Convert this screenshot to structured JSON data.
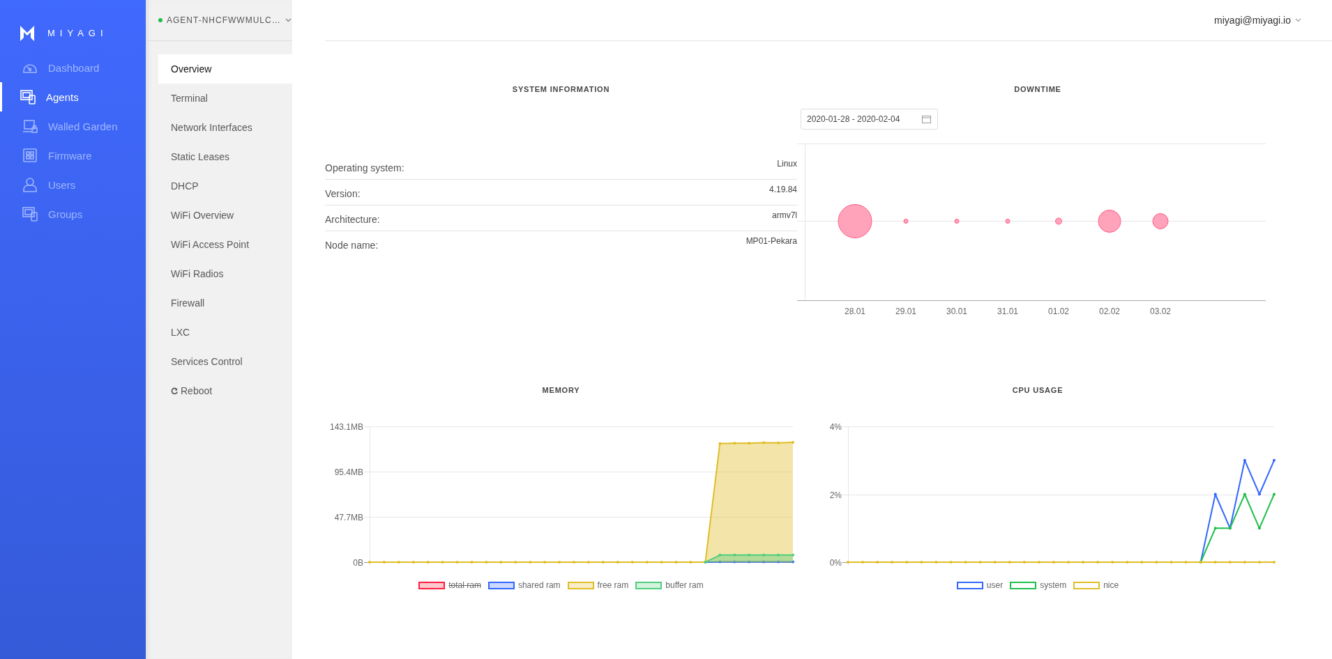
{
  "sidebar": {
    "logo": "MIYAGI",
    "items": [
      {
        "label": "Dashboard",
        "selected": false
      },
      {
        "label": "Agents",
        "selected": true
      },
      {
        "label": "Walled Garden",
        "selected": false
      },
      {
        "label": "Firmware",
        "selected": false
      },
      {
        "label": "Users",
        "selected": false
      },
      {
        "label": "Groups",
        "selected": false
      }
    ]
  },
  "agent_menu": {
    "agent": "AGENT-NHCFWWMULC…",
    "online": true,
    "items": [
      {
        "label": "Overview",
        "kind": "page",
        "selected": true
      },
      {
        "label": "Terminal",
        "kind": "page",
        "selected": false
      },
      {
        "label": "Network Interfaces",
        "kind": "page",
        "selected": false
      },
      {
        "label": "Static Leases",
        "kind": "page",
        "selected": false
      },
      {
        "label": "DHCP",
        "kind": "page",
        "selected": false
      },
      {
        "label": "WiFi Overview",
        "kind": "page",
        "selected": false
      },
      {
        "label": "WiFi Access Point",
        "kind": "page",
        "selected": false
      },
      {
        "label": "WiFi Radios",
        "kind": "page",
        "selected": false
      },
      {
        "label": "Firewall",
        "kind": "page",
        "selected": false
      },
      {
        "label": "LXC",
        "kind": "page",
        "selected": false
      },
      {
        "label": "Services Control",
        "kind": "page",
        "selected": false
      },
      {
        "label": "Reboot",
        "kind": "action",
        "selected": false
      }
    ]
  },
  "header": {
    "user": "miyagi@miyagi.io"
  },
  "system_information": {
    "title": "SYSTEM INFORMATION",
    "rows": [
      {
        "label": "Operating system:",
        "value": "Linux"
      },
      {
        "label": "Version:",
        "value": "4.19.84"
      },
      {
        "label": "Architecture:",
        "value": "armv7l"
      },
      {
        "label": "Node name:",
        "value": "MP01-Pekara"
      }
    ]
  },
  "downtime": {
    "title": "DOWNTIME",
    "date_range": "2020-01-28 - 2020-02-04",
    "x_labels": [
      "28.01",
      "29.01",
      "30.01",
      "31.01",
      "01.02",
      "02.02",
      "03.02"
    ]
  },
  "memory": {
    "title": "MEMORY",
    "legend": [
      {
        "hidden": true
      },
      {
        "hidden": false
      },
      {
        "hidden": false
      },
      {
        "hidden": false
      }
    ],
    "chart_data": {
      "type": "area",
      "ylim": [
        0,
        143.1
      ],
      "yticks": [
        {
          "value": 0,
          "label": "0B"
        },
        {
          "value": 47.7,
          "label": "47.7MB"
        },
        {
          "value": 95.4,
          "label": "95.4MB"
        },
        {
          "value": 143.1,
          "label": "143.1MB"
        }
      ],
      "series": [
        {
          "name": "total ram",
          "color": "#ff1f3d",
          "values": [
            null,
            null,
            null,
            null,
            null,
            null,
            null,
            null,
            null,
            null,
            null,
            null,
            null,
            null,
            null,
            null,
            null,
            null,
            null,
            null,
            null,
            null,
            null,
            null,
            null,
            null,
            null,
            null,
            null,
            null
          ]
        },
        {
          "name": "shared ram",
          "color": "#3366ff",
          "values": [
            null,
            null,
            null,
            null,
            null,
            null,
            null,
            null,
            null,
            null,
            null,
            null,
            null,
            null,
            null,
            null,
            null,
            null,
            null,
            null,
            null,
            null,
            null,
            0,
            0.3,
            0.3,
            0.3,
            0.3,
            0.3,
            0.3
          ]
        },
        {
          "name": "free ram",
          "color": "#e0bd27",
          "values": [
            0,
            0,
            0,
            0,
            0,
            0,
            0,
            0,
            0,
            0,
            0,
            0,
            0,
            0,
            0,
            0,
            0,
            0,
            0,
            0,
            0,
            0,
            0,
            0,
            125,
            125.3,
            125.3,
            125.8,
            125.6,
            126.2
          ]
        },
        {
          "name": "buffer ram",
          "color": "#4fce7d",
          "values": [
            null,
            null,
            null,
            null,
            null,
            null,
            null,
            null,
            null,
            null,
            null,
            null,
            null,
            null,
            null,
            null,
            null,
            null,
            null,
            null,
            null,
            null,
            null,
            0,
            7.5,
            7.5,
            7.5,
            7.5,
            7.5,
            7.5
          ]
        }
      ]
    }
  },
  "cpu_usage": {
    "title": "CPU USAGE",
    "legend": [
      {
        "hidden": false
      },
      {
        "hidden": false
      },
      {
        "hidden": false
      }
    ],
    "chart_data": {
      "type": "line",
      "ylim": [
        0,
        4
      ],
      "yticks": [
        {
          "value": 0,
          "label": "0%"
        },
        {
          "value": 2,
          "label": "2%"
        },
        {
          "value": 4,
          "label": "4%"
        }
      ],
      "series": [
        {
          "name": "user",
          "color": "#3366ff",
          "values": [
            null,
            null,
            null,
            null,
            null,
            null,
            null,
            null,
            null,
            null,
            null,
            null,
            null,
            null,
            null,
            null,
            null,
            null,
            null,
            null,
            null,
            null,
            null,
            null,
            0,
            2,
            1,
            3,
            2,
            3
          ]
        },
        {
          "name": "system",
          "color": "#1ebf49",
          "values": [
            null,
            null,
            null,
            null,
            null,
            null,
            null,
            null,
            null,
            null,
            null,
            null,
            null,
            null,
            null,
            null,
            null,
            null,
            null,
            null,
            null,
            null,
            null,
            null,
            0,
            1,
            1,
            2,
            1,
            2
          ]
        },
        {
          "name": "nice",
          "color": "#e0bd27",
          "values": [
            0,
            0,
            0,
            0,
            0,
            0,
            0,
            0,
            0,
            0,
            0,
            0,
            0,
            0,
            0,
            0,
            0,
            0,
            0,
            0,
            0,
            0,
            0,
            0,
            0,
            0,
            0,
            0,
            0,
            0
          ]
        }
      ]
    }
  }
}
